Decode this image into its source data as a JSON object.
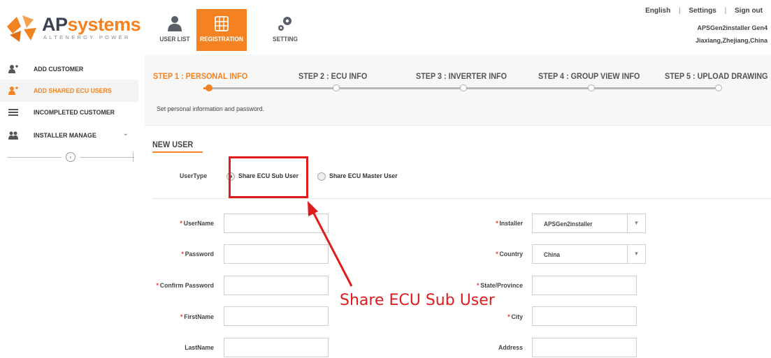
{
  "brand": {
    "name_part1": "AP",
    "name_part2": "systems",
    "tagline": "ALTENERGY POWER",
    "logo_icon": "apsystems-logo"
  },
  "nav": {
    "user_list": {
      "label": "USER LIST",
      "icon": "users-icon"
    },
    "registration": {
      "label": "REGISTRATION",
      "icon": "grid-icon"
    },
    "setting": {
      "label": "SETTING",
      "icon": "gears-icon"
    }
  },
  "top_links": {
    "language": "English",
    "settings": "Settings",
    "sign_out": "Sign out",
    "separator": "|"
  },
  "account": {
    "name": "APSGen2installer Gen4",
    "location": "Jiaxiang,Zhejiang,China"
  },
  "sidebar": {
    "items": [
      {
        "label": "ADD CUSTOMER",
        "icon": "add-user-icon"
      },
      {
        "label": "ADD SHARED ECU USERS",
        "icon": "add-user-icon"
      },
      {
        "label": "INCOMPLETED CUSTOMER",
        "icon": "list-icon"
      },
      {
        "label": "INSTALLER MANAGE",
        "icon": "users-icon"
      }
    ],
    "collapse_icon": "chevron-left-icon"
  },
  "steps": [
    {
      "label": "STEP 1 : PERSONAL INFO",
      "active": true
    },
    {
      "label": "STEP 2 : ECU INFO",
      "active": false
    },
    {
      "label": "STEP 3 : INVERTER INFO",
      "active": false
    },
    {
      "label": "STEP 4 : GROUP VIEW INFO",
      "active": false
    },
    {
      "label": "STEP 5 : UPLOAD DRAWING",
      "active": false
    }
  ],
  "step_description": "Set personal information and password.",
  "section_title": "NEW USER",
  "user_type": {
    "label": "UserType",
    "options": [
      {
        "label": "Share ECU Sub User",
        "selected": true
      },
      {
        "label": "Share ECU Master User",
        "selected": false
      }
    ]
  },
  "form": {
    "required_mark": "*",
    "username_label": "UserName",
    "password_label": "Password",
    "confirm_password_label": "Confirm Password",
    "firstname_label": "FirstName",
    "lastname_label": "LastName",
    "installer_label": "Installer",
    "installer_value": "APSGen2installer",
    "country_label": "Country",
    "country_value": "China",
    "state_label": "State/Province",
    "city_label": "City",
    "address_label": "Address"
  },
  "annotation": {
    "text": "Share ECU Sub User",
    "color": "#e01b1b"
  },
  "colors": {
    "accent": "#f58220",
    "brand_dark": "#3a4150"
  }
}
